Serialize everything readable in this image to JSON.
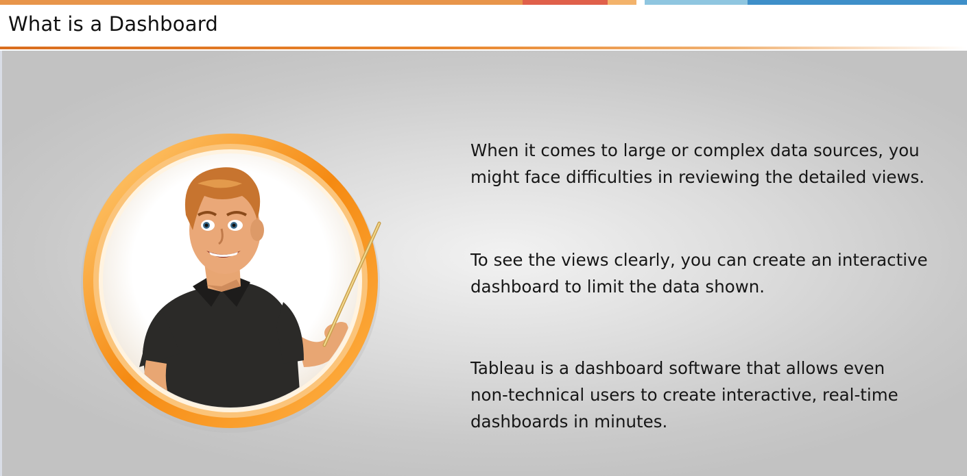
{
  "slide": {
    "title": "What is a Dashboard",
    "paragraphs": [
      {
        "lines": [
          "When it comes to large or complex data sources, you",
          "might face difficulties in reviewing the detailed views."
        ]
      },
      {
        "lines": [
          "To see the views clearly, you can create an interactive",
          "dashboard to limit the data shown."
        ]
      },
      {
        "lines": [
          "Tableau is a dashboard software that allows even",
          "non-technical users to create interactive, real-time",
          "dashboards in minutes."
        ]
      }
    ],
    "illustration": {
      "icon": "presenter-icon"
    }
  },
  "colors": {
    "stripe_orange": "#e8954a",
    "stripe_red": "#e0604a",
    "stripe_light_orange": "#f3b36b",
    "stripe_light_blue": "#8fc6e0",
    "stripe_blue": "#3e8fc9",
    "accent_line": "#e07a1f",
    "ring_orange": "#f47a0a"
  }
}
